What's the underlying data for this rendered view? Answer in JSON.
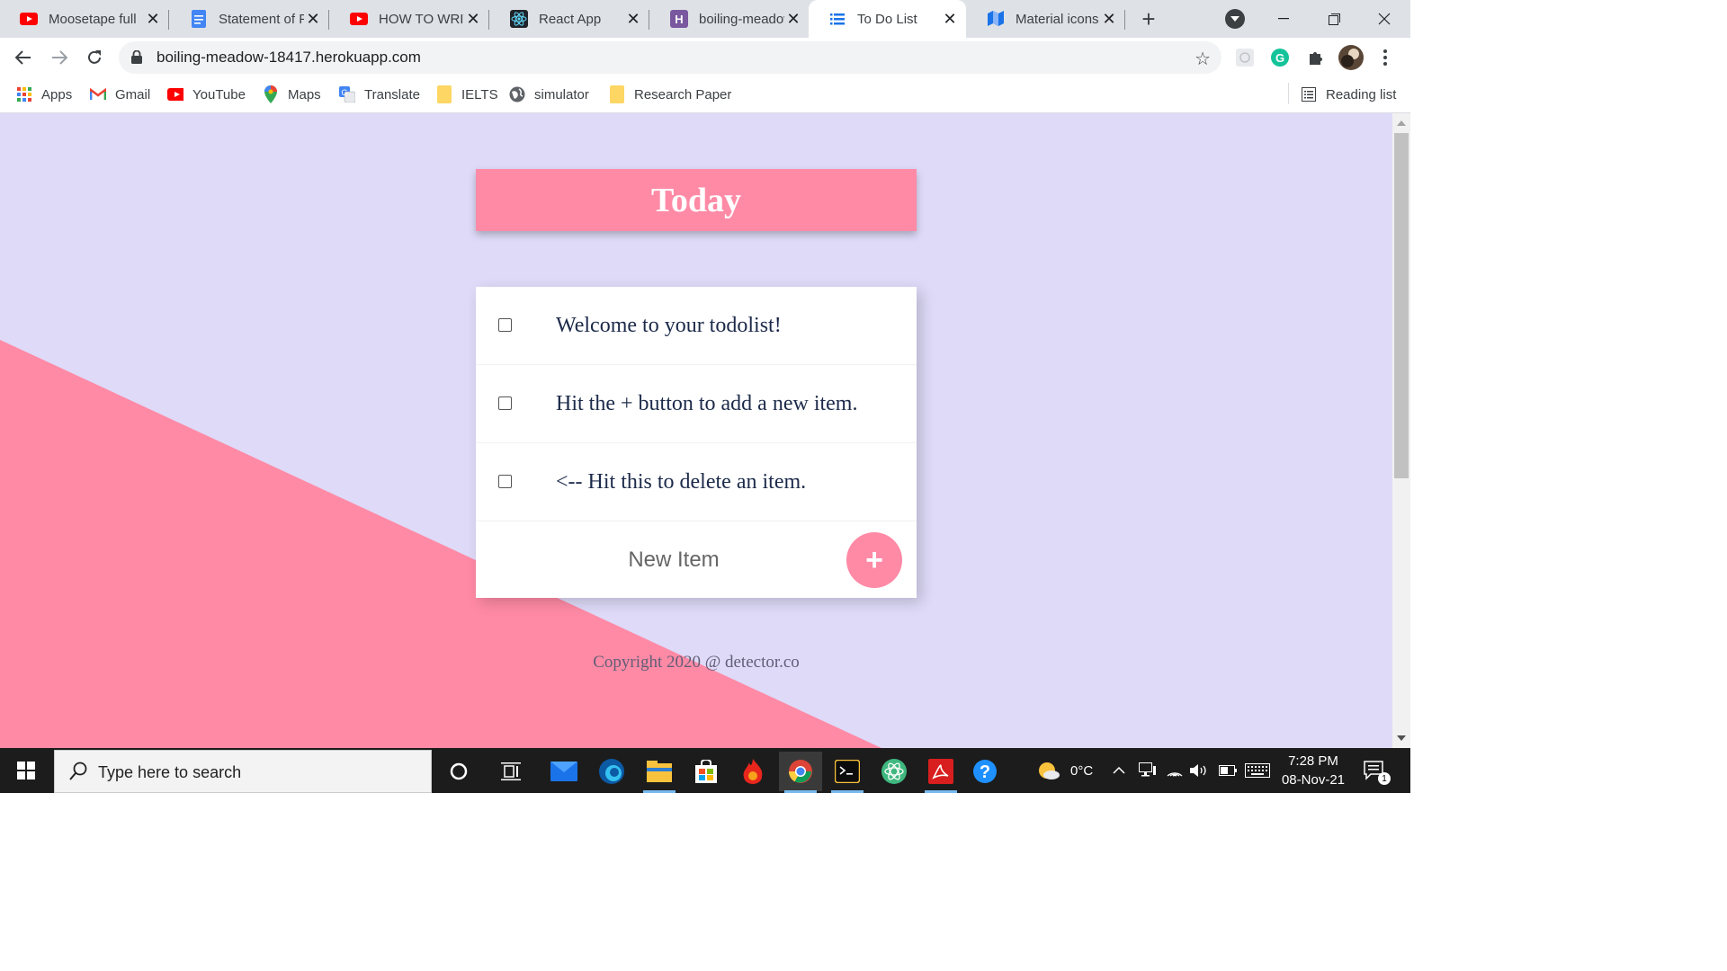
{
  "browser": {
    "tabs": [
      {
        "title": "Moosetape full",
        "icon": "youtube-icon"
      },
      {
        "title": "Statement of Pu",
        "icon": "google-docs-icon"
      },
      {
        "title": "HOW TO WRITE",
        "icon": "youtube-icon"
      },
      {
        "title": "React App",
        "icon": "react-icon"
      },
      {
        "title": "boiling-meadow",
        "icon": "heroku-icon"
      },
      {
        "title": "To Do List",
        "icon": "list-icon",
        "active": true
      },
      {
        "title": "Material icons",
        "icon": "material-icon"
      }
    ],
    "url": "boiling-meadow-18417.herokuapp.com",
    "bookmarks": [
      {
        "label": "Apps",
        "icon": "apps-grid-icon"
      },
      {
        "label": "Gmail",
        "icon": "gmail-icon"
      },
      {
        "label": "YouTube",
        "icon": "youtube-icon"
      },
      {
        "label": "Maps",
        "icon": "maps-pin-icon"
      },
      {
        "label": "Translate",
        "icon": "translate-icon"
      },
      {
        "label": "IELTS",
        "icon": "folder-icon"
      },
      {
        "label": "simulator",
        "icon": "globe-icon"
      },
      {
        "label": "Research Paper",
        "icon": "folder-icon"
      }
    ],
    "reading_list": "Reading list"
  },
  "app": {
    "heading": "Today",
    "items": [
      {
        "text": "Welcome to your todolist!",
        "checked": false
      },
      {
        "text": "Hit the + button to add a new item.",
        "checked": false
      },
      {
        "text": "<-- Hit this to delete an item.",
        "checked": false
      }
    ],
    "new_item_placeholder": "New Item",
    "add_button": "+",
    "footer": "Copyright 2020 @ detector.co",
    "colors": {
      "accent": "#ff8aa6",
      "background": "#dedaf8",
      "text": "#1c2a4a"
    }
  },
  "taskbar": {
    "search_placeholder": "Type here to search",
    "weather": "0°C",
    "time": "7:28 PM",
    "date": "08-Nov-21",
    "notifications": "1"
  }
}
